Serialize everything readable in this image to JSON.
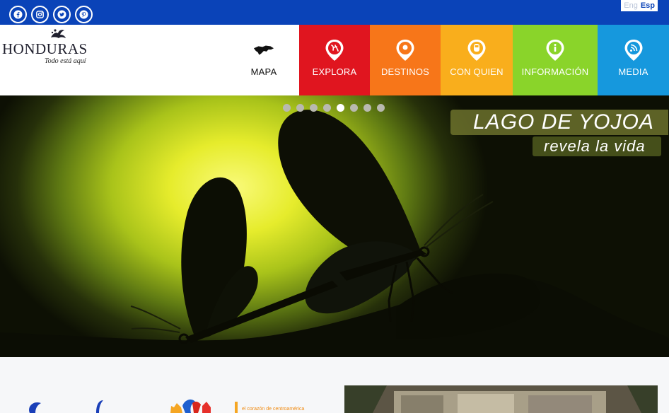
{
  "social": {
    "items": [
      {
        "name": "facebook-icon",
        "glyph": "f"
      },
      {
        "name": "instagram-icon",
        "glyph": "ig"
      },
      {
        "name": "twitter-icon",
        "glyph": "t"
      },
      {
        "name": "pinterest-icon",
        "glyph": "p"
      }
    ]
  },
  "language": {
    "eng": "Eng",
    "esp": "Esp",
    "active": "Esp"
  },
  "logo": {
    "name": "HONDURAS",
    "tagline": "Todo está aquí"
  },
  "nav": {
    "mapa": "MAPA",
    "explora": "EXPLORA",
    "destinos": "DESTINOS",
    "con_quien": "CON QUIEN",
    "informacion": "INFORMACIÓN",
    "media": "MEDIA"
  },
  "colors": {
    "topbar": "#0a43b8",
    "explora": "#e0151f",
    "destinos": "#f77619",
    "con_quien": "#f9ae1c",
    "informacion": "#8ad42a",
    "media": "#1698dd"
  },
  "hero": {
    "title": "LAGO DE YOJOA",
    "subtitle": "revela la vida",
    "slides_count": 8,
    "active_slide": 5
  },
  "bottom": {
    "small_tagline": "el corazón de centroamérica"
  }
}
